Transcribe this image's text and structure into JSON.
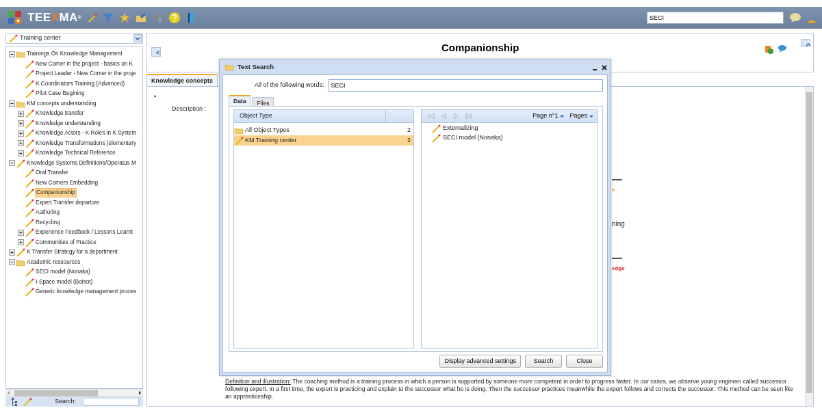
{
  "toolbar": {
    "logo": {
      "before": "TEE",
      "accent": "X",
      "after": "MA",
      "mark": "®"
    },
    "search_value": "SECI"
  },
  "sidebar": {
    "selector": "Training center",
    "search_label": "Search:",
    "tree": [
      {
        "label": "Trainings On Knowledge Management",
        "kind": "folder",
        "expandable": true,
        "expanded": true,
        "selected": false,
        "children": [
          {
            "label": "New Comer in the project - basics on K",
            "kind": "pencil",
            "expandable": false,
            "selected": false
          },
          {
            "label": "Project Leader - New Comer in the proje",
            "kind": "pencil",
            "expandable": false,
            "selected": false
          },
          {
            "label": "K Coordinators Training (Advanced)",
            "kind": "pencil",
            "expandable": false,
            "selected": false
          },
          {
            "label": "Pilot Case Begining",
            "kind": "pencil",
            "expandable": false,
            "selected": false
          }
        ]
      },
      {
        "label": "KM concepts understanding",
        "kind": "folder",
        "expandable": true,
        "expanded": true,
        "selected": false,
        "children": [
          {
            "label": "Knowledge transfer",
            "kind": "pencil",
            "expandable": true,
            "expanded": false,
            "selected": false
          },
          {
            "label": "Knowledge understanding",
            "kind": "pencil",
            "expandable": true,
            "expanded": false,
            "selected": false
          },
          {
            "label": "Knowledge Actors - K Roles in K System",
            "kind": "pencil",
            "expandable": true,
            "expanded": false,
            "selected": false
          },
          {
            "label": "Knowledge Transformations (elementary",
            "kind": "pencil",
            "expandable": true,
            "expanded": false,
            "selected": false
          },
          {
            "label": "Knowledge Technical Reference",
            "kind": "pencil",
            "expandable": true,
            "expanded": false,
            "selected": false
          }
        ]
      },
      {
        "label": "Knowledge Systems Definitions/Operatus M",
        "kind": "pencil",
        "expandable": true,
        "expanded": true,
        "selected": false,
        "children": [
          {
            "label": "Oral Transfer",
            "kind": "pencil",
            "expandable": false,
            "selected": false
          },
          {
            "label": "New Comers Embedding",
            "kind": "pencil",
            "expandable": false,
            "selected": false
          },
          {
            "label": "Companionship",
            "kind": "pencil",
            "expandable": false,
            "selected": true
          },
          {
            "label": "Expert Transfer departure",
            "kind": "pencil",
            "expandable": false,
            "selected": false
          },
          {
            "label": "Authoring",
            "kind": "pencil",
            "expandable": false,
            "selected": false
          },
          {
            "label": "Recycling",
            "kind": "pencil",
            "expandable": false,
            "selected": false
          },
          {
            "label": "Experience Feedback / Lessons Learnt",
            "kind": "pencil",
            "expandable": true,
            "expanded": false,
            "selected": false
          },
          {
            "label": "Communities of Practice",
            "kind": "pencil",
            "expandable": true,
            "expanded": false,
            "selected": false
          }
        ]
      },
      {
        "label": "K Transfer Strategy for a department",
        "kind": "pencil",
        "expandable": true,
        "expanded": false,
        "selected": false
      },
      {
        "label": "Academic ressources",
        "kind": "folder",
        "expandable": true,
        "expanded": true,
        "selected": false,
        "children": [
          {
            "label": "SECI model (Nonaka)",
            "kind": "pencil",
            "expandable": false,
            "selected": false
          },
          {
            "label": "I-Space model (Boisot)",
            "kind": "pencil",
            "expandable": false,
            "selected": false
          },
          {
            "label": "Generic knowledge management proces",
            "kind": "pencil",
            "expandable": false,
            "selected": false
          }
        ]
      }
    ]
  },
  "page": {
    "back_label": "<",
    "title": "Companionship",
    "tabs": [
      {
        "label": "Knowledge concepts",
        "selected": true
      }
    ],
    "bullet": "•",
    "description_label": "Description :",
    "fragments": [
      {
        "text": "e",
        "kind": "warning"
      },
      {
        "text": "ning",
        "kind": "plain"
      },
      {
        "text": "edge",
        "kind": "alert"
      }
    ],
    "definition": {
      "label": "Definition and illustration:",
      "text": "The coaching method is a training process in which a person is supported by someone more competent in order to progress faster. In our cases, we observe young engineer called successor following expert. In a first time, the expert is practicing and explain to the successor what he is doing. Then the successor practices meanwhile the expert follows and corrects the successor. This method can be seen like an apprenticeship."
    }
  },
  "dialog": {
    "title": "Text Search",
    "words_label": "All of the following words:",
    "words_value": "SECI",
    "tabs": [
      {
        "label": "Data",
        "selected": true
      },
      {
        "label": "Files",
        "selected": false
      }
    ],
    "columns": [
      "Object Type"
    ],
    "rows": [
      {
        "label": "All Object Types",
        "count": "2",
        "kind": "folder",
        "selected": false
      },
      {
        "label": "KM Training center",
        "count": "2",
        "kind": "pencil",
        "selected": true
      }
    ],
    "pager": {
      "page": "Page n°1",
      "pages": "Pages"
    },
    "results": [
      {
        "label": "Externalizing"
      },
      {
        "label": "SECI model (Nonaka)"
      }
    ],
    "buttons": [
      "Display advanced settings",
      "Search",
      "Close"
    ]
  }
}
